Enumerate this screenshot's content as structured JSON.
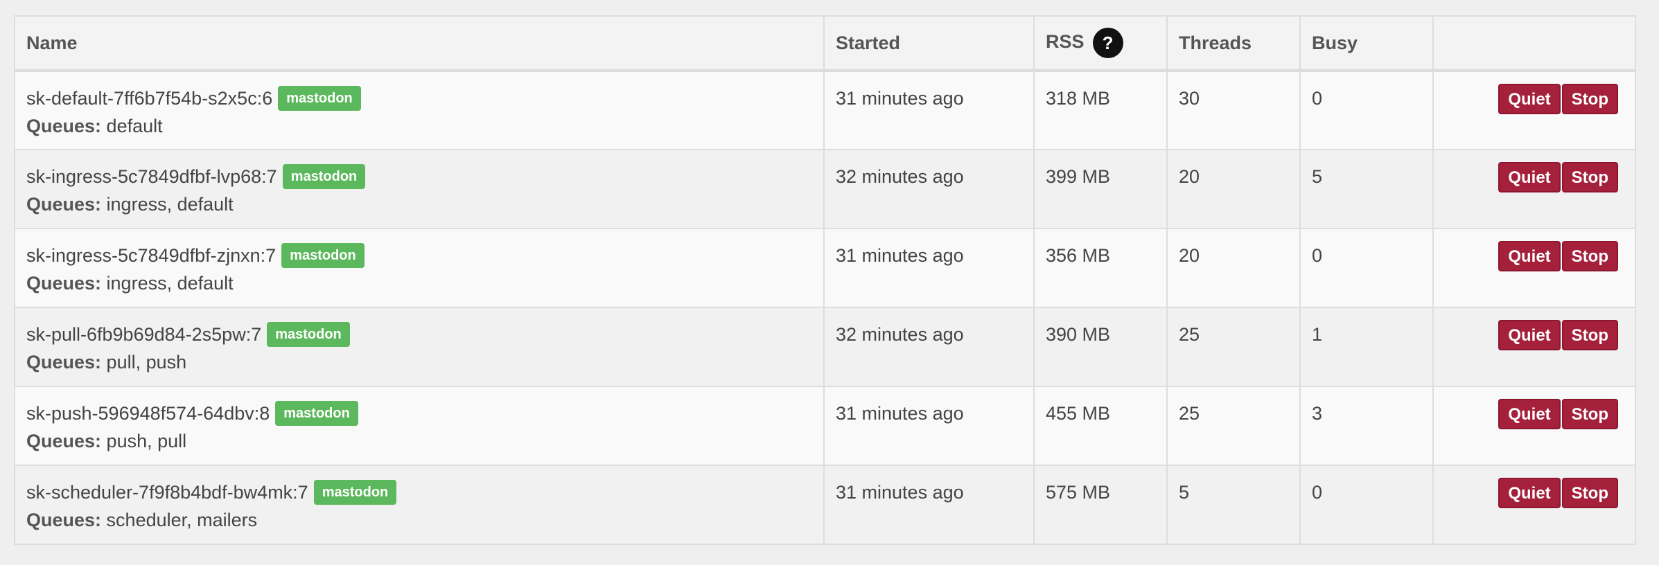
{
  "table": {
    "headers": {
      "name": "Name",
      "started": "Started",
      "rss": "RSS",
      "rss_help": "?",
      "threads": "Threads",
      "busy": "Busy",
      "actions": ""
    },
    "queues_label": "Queues:",
    "quiet_label": "Quiet",
    "stop_label": "Stop",
    "rows": [
      {
        "name": "sk-default-7ff6b7f54b-s2x5c:6",
        "tag": "mastodon",
        "queues": "default",
        "started": "31 minutes ago",
        "rss": "318 MB",
        "threads": "30",
        "busy": "0"
      },
      {
        "name": "sk-ingress-5c7849dfbf-lvp68:7",
        "tag": "mastodon",
        "queues": "ingress, default",
        "started": "32 minutes ago",
        "rss": "399 MB",
        "threads": "20",
        "busy": "5"
      },
      {
        "name": "sk-ingress-5c7849dfbf-zjnxn:7",
        "tag": "mastodon",
        "queues": "ingress, default",
        "started": "31 minutes ago",
        "rss": "356 MB",
        "threads": "20",
        "busy": "0"
      },
      {
        "name": "sk-pull-6fb9b69d84-2s5pw:7",
        "tag": "mastodon",
        "queues": "pull, push",
        "started": "32 minutes ago",
        "rss": "390 MB",
        "threads": "25",
        "busy": "1"
      },
      {
        "name": "sk-push-596948f574-64dbv:8",
        "tag": "mastodon",
        "queues": "push, pull",
        "started": "31 minutes ago",
        "rss": "455 MB",
        "threads": "25",
        "busy": "3"
      },
      {
        "name": "sk-scheduler-7f9f8b4bdf-bw4mk:7",
        "tag": "mastodon",
        "queues": "scheduler, mailers",
        "started": "31 minutes ago",
        "rss": "575 MB",
        "threads": "5",
        "busy": "0"
      }
    ]
  }
}
